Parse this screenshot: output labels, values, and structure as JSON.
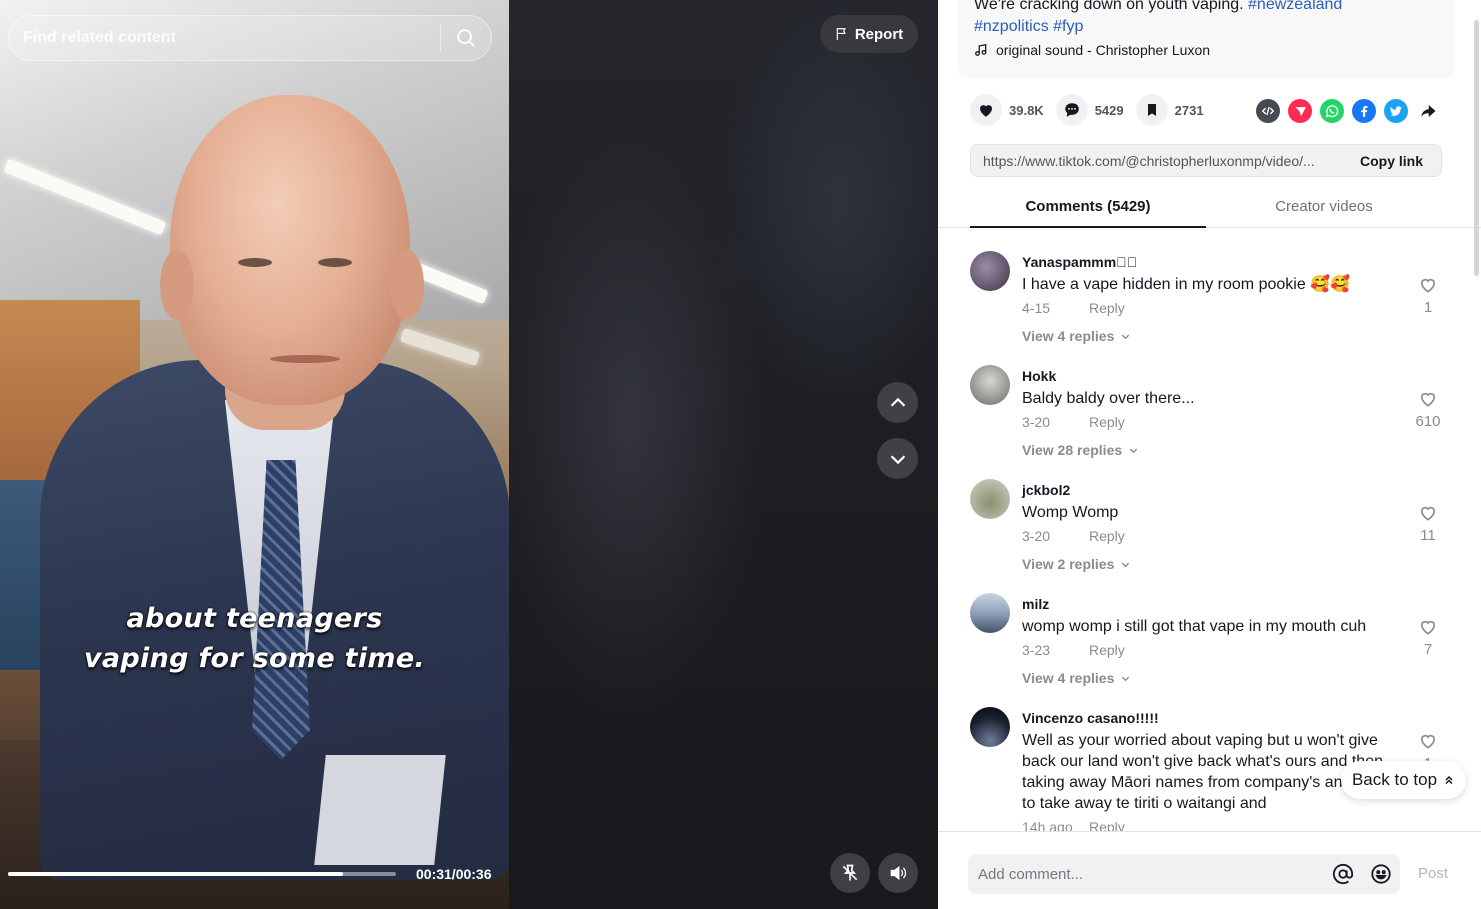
{
  "search": {
    "placeholder": "Find related content"
  },
  "report": {
    "label": "Report"
  },
  "video": {
    "caption_line1": "about teenagers",
    "caption_line2": "vaping for some time.",
    "progress": 0.863,
    "time": "00:31/00:36"
  },
  "post": {
    "description_line1": "We're cracking down on youth vaping.",
    "hashtag_newzealand": "#newzealand",
    "hashtag_nzpolitics": "#nzpolitics",
    "hashtag_fyp": "#fyp",
    "music": "original sound - Christopher Luxon"
  },
  "stats": {
    "likes": "39.8K",
    "comments": "5429",
    "bookmarks": "2731"
  },
  "share": {
    "link": "https://www.tiktok.com/@christopherluxonmp/video/...",
    "copy_label": "Copy link"
  },
  "tabs": {
    "comments": "Comments (5429)",
    "creator": "Creator videos"
  },
  "comments": [
    {
      "user": "Yanaspammm\u0000\u0000",
      "text": "I have a vape hidden in my room pookie 🥰🥰",
      "date": "4-15",
      "reply": "Reply",
      "view": "View 4 replies",
      "likes": "1"
    },
    {
      "user": "Hokk",
      "text": "Baldy baldy over there...",
      "date": "3-20",
      "reply": "Reply",
      "view": "View 28 replies",
      "likes": "610"
    },
    {
      "user": "jckbol2",
      "text": "Womp Womp",
      "date": "3-20",
      "reply": "Reply",
      "view": "View 2 replies",
      "likes": "11"
    },
    {
      "user": "milz",
      "text": "womp womp i still got that vape in my mouth cuh",
      "date": "3-23",
      "reply": "Reply",
      "view": "View 4 replies",
      "likes": "7"
    },
    {
      "user": "Vincenzo casano!!!!!",
      "text": "Well as your worried about vaping but u won't give back our land won't give back what's ours and then taking away Māori names from company's and trying to take away te tiriti o waitangi and",
      "date": "14h ago",
      "reply": "Reply",
      "likes": "1"
    }
  ],
  "back_to_top": "Back to top",
  "comment_box": {
    "placeholder": "Add comment...",
    "post_label": "Post"
  },
  "colors": {
    "hashtag": "#2b5db9",
    "red_share": "#fe2c55",
    "whatsapp": "#25d366",
    "facebook": "#1877f2",
    "twitter": "#1da1f2"
  }
}
